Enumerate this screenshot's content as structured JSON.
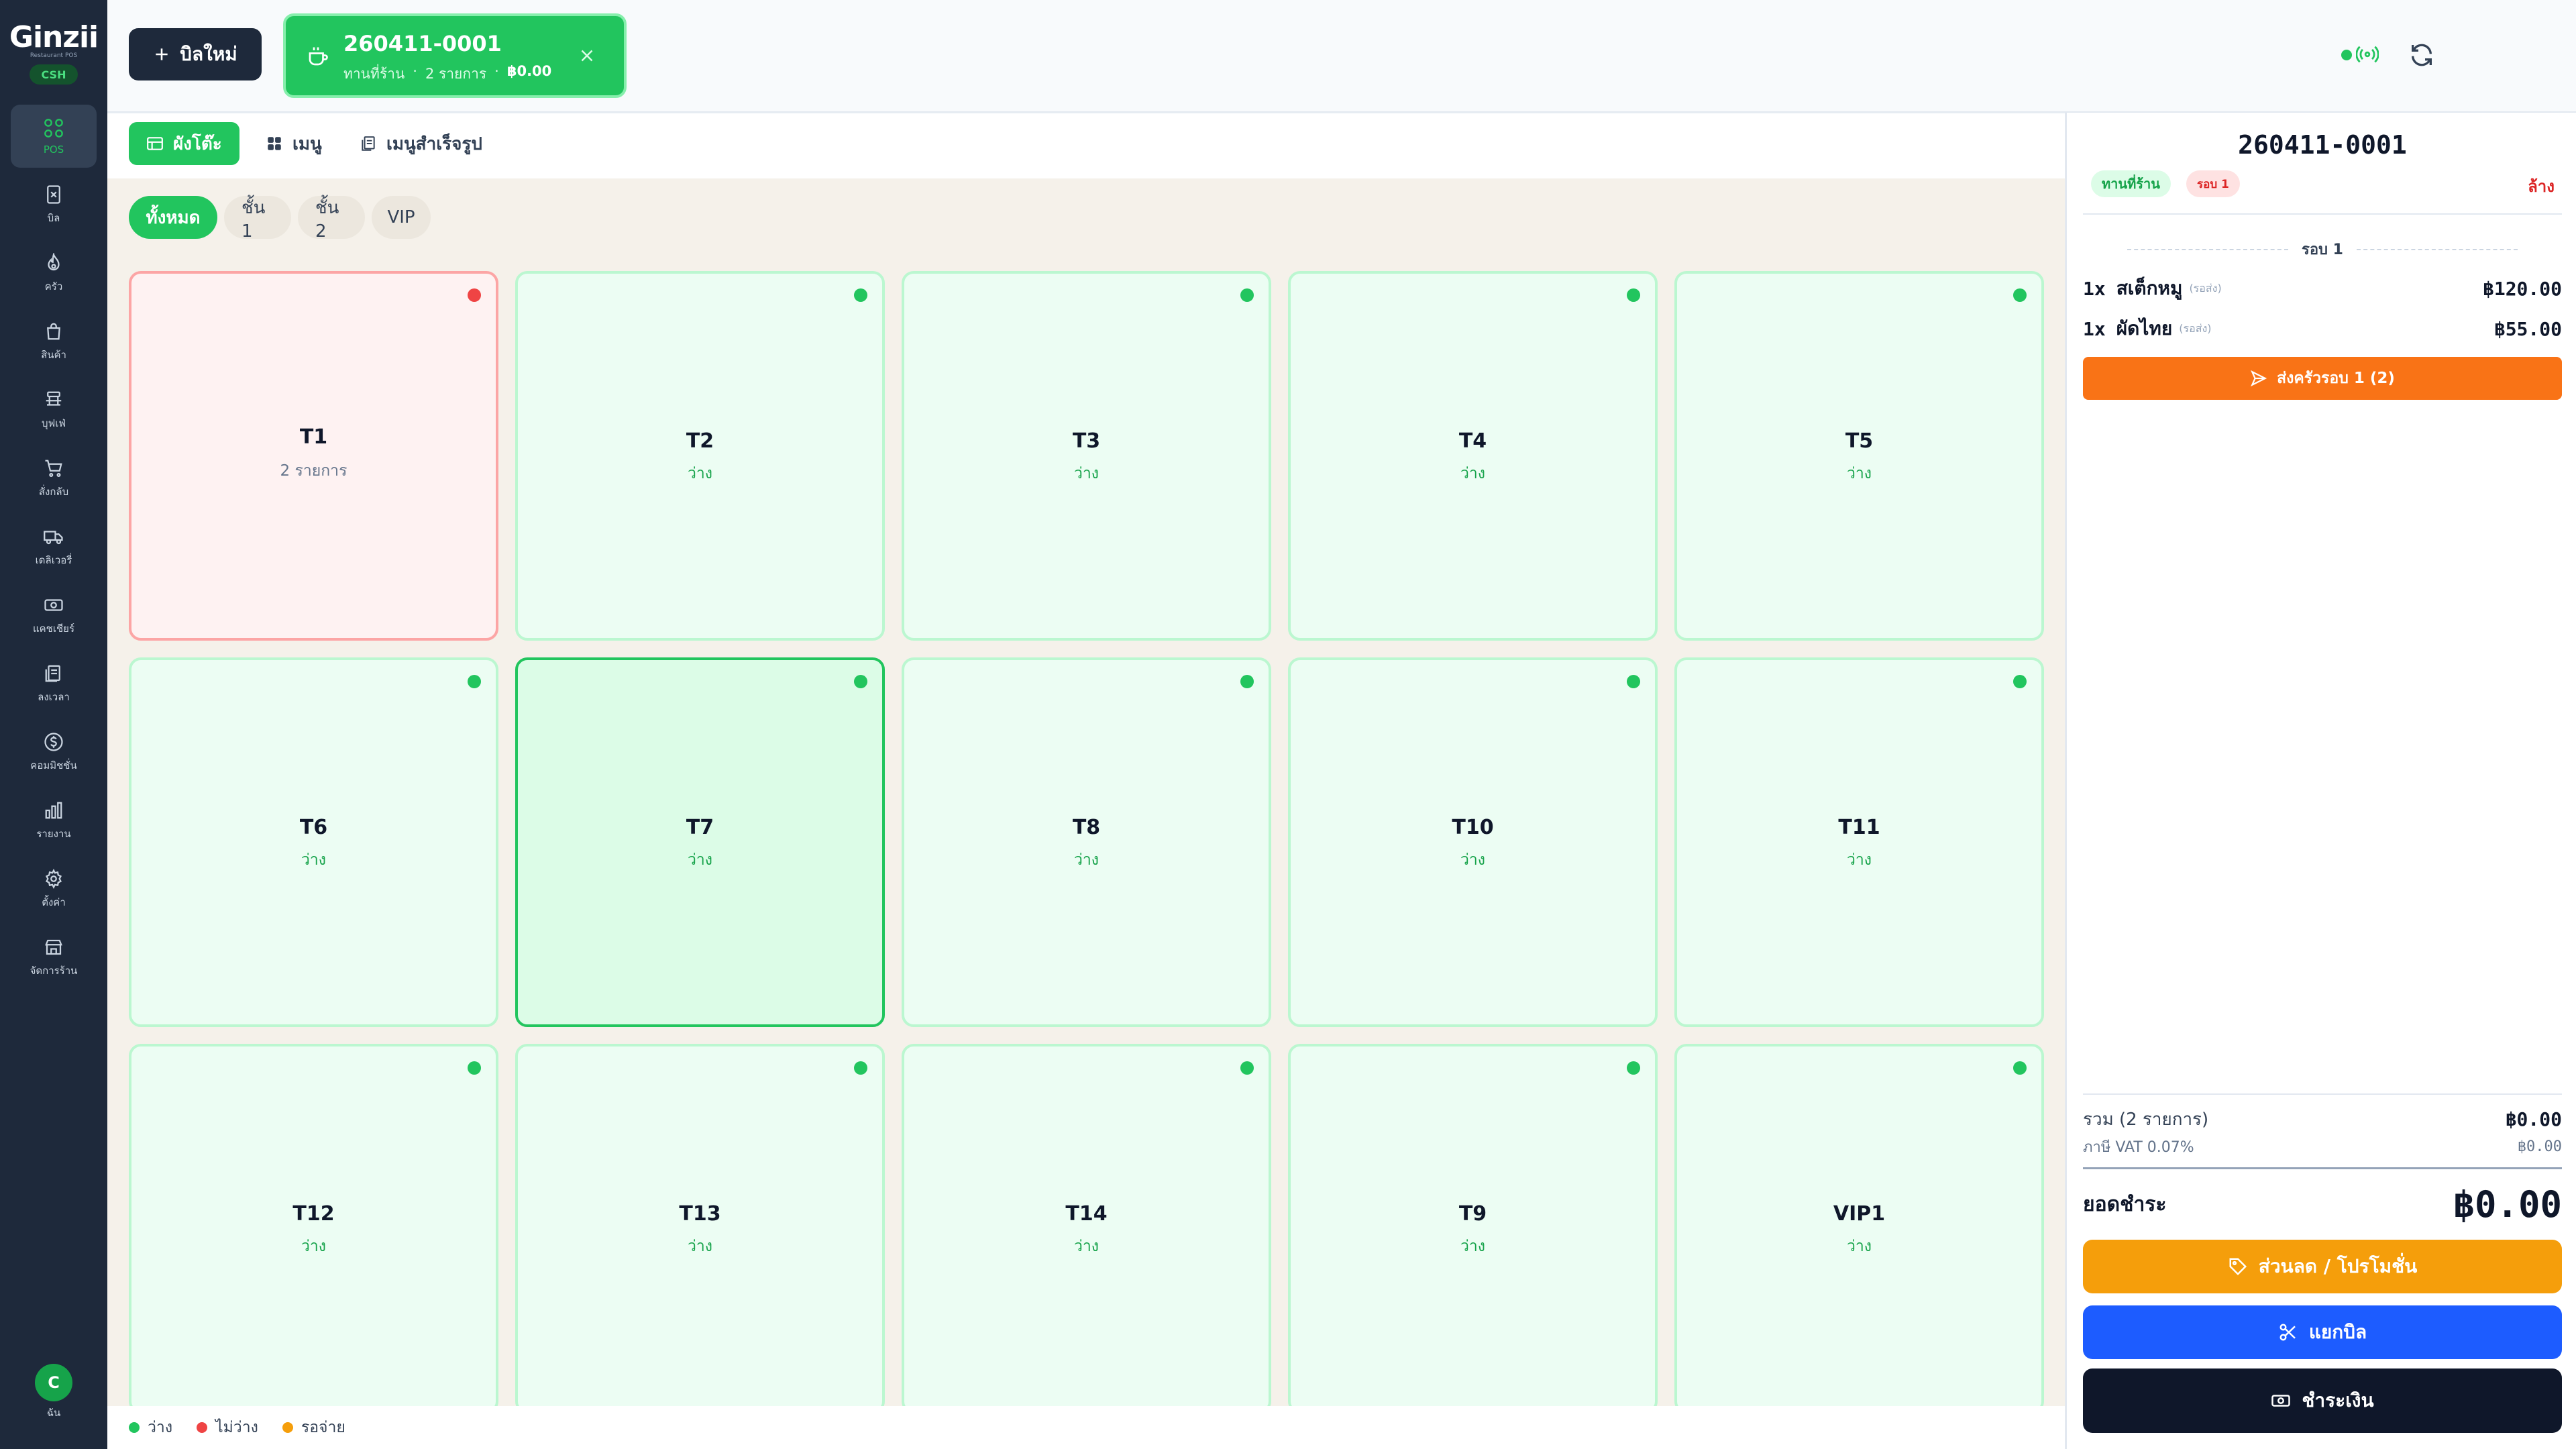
{
  "app": {
    "logo": "Ginzii",
    "logo_sub": "Restaurant POS",
    "role": "CSH",
    "user_initial": "C",
    "user_label": "ฉัน"
  },
  "sidebar": {
    "items": [
      {
        "label": "POS",
        "icon": "grid-icon",
        "active": true
      },
      {
        "label": "บิล",
        "icon": "receipt-icon"
      },
      {
        "label": "ครัว",
        "icon": "flame-icon"
      },
      {
        "label": "สินค้า",
        "icon": "bag-icon"
      },
      {
        "label": "บุฟเฟ่",
        "icon": "buffet-icon"
      },
      {
        "label": "สั่งกลับ",
        "icon": "cart-icon"
      },
      {
        "label": "เดลิเวอรี่",
        "icon": "truck-icon"
      },
      {
        "label": "แคชเชียร์",
        "icon": "cash-icon"
      },
      {
        "label": "ลงเวลา",
        "icon": "clipboard-icon"
      },
      {
        "label": "คอมมิชชั่น",
        "icon": "dollar-icon"
      },
      {
        "label": "รายงาน",
        "icon": "bar-chart-icon"
      },
      {
        "label": "ตั้งค่า",
        "icon": "gear-icon"
      },
      {
        "label": "จัดการร้าน",
        "icon": "store-icon"
      }
    ]
  },
  "topbar": {
    "new_bill_label": "บิลใหม่",
    "active_bill": {
      "number": "260411-0001",
      "type": "ทานที่ร้าน",
      "sep": "·",
      "count": "2 รายการ",
      "amount": "฿0.00"
    }
  },
  "view_tabs": [
    {
      "label": "ผังโต๊ะ",
      "active": true
    },
    {
      "label": "เมนู"
    },
    {
      "label": "เมนูสำเร็จรูป"
    }
  ],
  "zones": [
    {
      "label": "ทั้งหมด",
      "active": true
    },
    {
      "label": "ชั้น 1"
    },
    {
      "label": "ชั้น 2"
    },
    {
      "label": "VIP"
    }
  ],
  "tables": [
    {
      "name": "T1",
      "status": "2 รายการ",
      "state": "occupied"
    },
    {
      "name": "T2",
      "status": "ว่าง",
      "state": "free"
    },
    {
      "name": "T3",
      "status": "ว่าง",
      "state": "free"
    },
    {
      "name": "T4",
      "status": "ว่าง",
      "state": "free"
    },
    {
      "name": "T5",
      "status": "ว่าง",
      "state": "free"
    },
    {
      "name": "T6",
      "status": "ว่าง",
      "state": "free"
    },
    {
      "name": "T7",
      "status": "ว่าง",
      "state": "selected"
    },
    {
      "name": "T8",
      "status": "ว่าง",
      "state": "free"
    },
    {
      "name": "T10",
      "status": "ว่าง",
      "state": "free"
    },
    {
      "name": "T11",
      "status": "ว่าง",
      "state": "free"
    },
    {
      "name": "T12",
      "status": "ว่าง",
      "state": "free"
    },
    {
      "name": "T13",
      "status": "ว่าง",
      "state": "free"
    },
    {
      "name": "T14",
      "status": "ว่าง",
      "state": "free"
    },
    {
      "name": "T9",
      "status": "ว่าง",
      "state": "free"
    },
    {
      "name": "VIP1",
      "status": "ว่าง",
      "state": "free"
    }
  ],
  "legend": [
    {
      "label": "ว่าง",
      "color": "#22c55e"
    },
    {
      "label": "ไม่ว่าง",
      "color": "#ef4444"
    },
    {
      "label": "รอจ่าย",
      "color": "#f59e0b"
    }
  ],
  "bill": {
    "number": "260411-0001",
    "type_badge": "ทานที่ร้าน",
    "round_badge": "รอบ 1",
    "clear_label": "ล้าง",
    "round_header": "รอบ 1",
    "items": [
      {
        "qty": "1x",
        "name": "สเต็กหมู",
        "status": "(รอส่ง)",
        "price": "฿120.00"
      },
      {
        "qty": "1x",
        "name": "ผัดไทย",
        "status": "(รอส่ง)",
        "price": "฿55.00"
      }
    ],
    "send_kitchen_label": "ส่งครัวรอบ 1 (2)",
    "subtotal_label": "รวม (2 รายการ)",
    "subtotal_value": "฿0.00",
    "vat_label": "ภาษี VAT 0.07%",
    "vat_value": "฿0.00",
    "total_label": "ยอดชำระ",
    "total_value": "฿0.00",
    "discount_label": "ส่วนลด / โปรโมชั่น",
    "split_label": "แยกบิล",
    "pay_label": "ชำระเงิน"
  },
  "colors": {
    "accent": "#22c55e",
    "sidebar": "#1e293b",
    "send": "#f97316",
    "discount": "#f59e0b",
    "split": "#1d5cff",
    "pay": "#0f172a"
  }
}
